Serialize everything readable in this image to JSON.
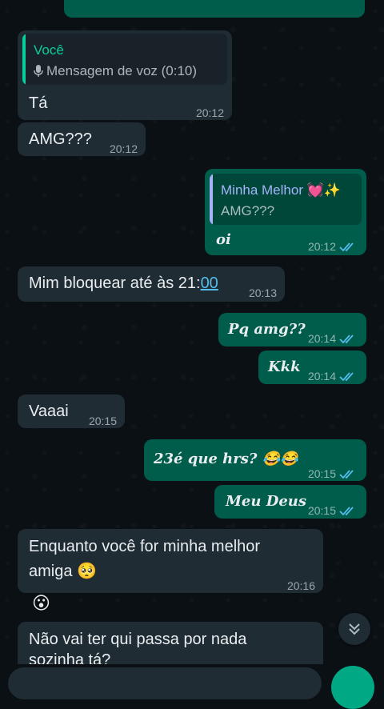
{
  "chat": {
    "messages": [
      {
        "id": "m1",
        "direction": "in",
        "reply_name": "Você",
        "reply_text": "Mensagem de voz (0:10)",
        "text": "Tá",
        "time": "20:12"
      },
      {
        "id": "m2",
        "direction": "in",
        "text": "AMG???",
        "time": "20:12"
      },
      {
        "id": "m3",
        "direction": "out",
        "reply_name": "Minha Melhor 💓✨",
        "reply_text": "AMG???",
        "text": "oi",
        "time": "20:12",
        "status": "read"
      },
      {
        "id": "m4",
        "direction": "in",
        "text_prefix": "Mim bloquear até às 21:",
        "text_link": "00",
        "time": "20:13"
      },
      {
        "id": "m5",
        "direction": "out",
        "text": "Pq amg??",
        "time": "20:14",
        "status": "read"
      },
      {
        "id": "m6",
        "direction": "out",
        "text": "Kkk",
        "time": "20:14",
        "status": "read"
      },
      {
        "id": "m7",
        "direction": "in",
        "text": "Vaaai",
        "time": "20:15"
      },
      {
        "id": "m8",
        "direction": "out",
        "text": "23é que hrs? 😂😂",
        "time": "20:15",
        "status": "read"
      },
      {
        "id": "m9",
        "direction": "out",
        "text": "Meu Deus",
        "time": "20:15",
        "status": "read"
      },
      {
        "id": "m10",
        "direction": "in",
        "text_line1": "Enquanto você for minha melhor",
        "text_line2": "amiga 🥺",
        "time": "20:16"
      },
      {
        "id": "m11",
        "direction": "in",
        "text": "😮",
        "time": ""
      },
      {
        "id": "m12",
        "direction": "in",
        "text_line1": "Não vai ter qui passa por nada",
        "text_line2": "sozinha tá?",
        "time": ""
      }
    ]
  },
  "colors": {
    "background": "#0b1014",
    "incoming_bubble": "#1f2c34",
    "outgoing_bubble": "#005c4b",
    "read_ticks": "#53bdeb",
    "reply_bar_incoming": "#06cf9c",
    "reply_bar_outgoing": "#a5b3f8",
    "accent_green": "#00a884"
  },
  "icons": {
    "mic_small": "mic-icon",
    "read_status": "double-check-icon",
    "scroll_down": "double-chevron-down-icon"
  }
}
